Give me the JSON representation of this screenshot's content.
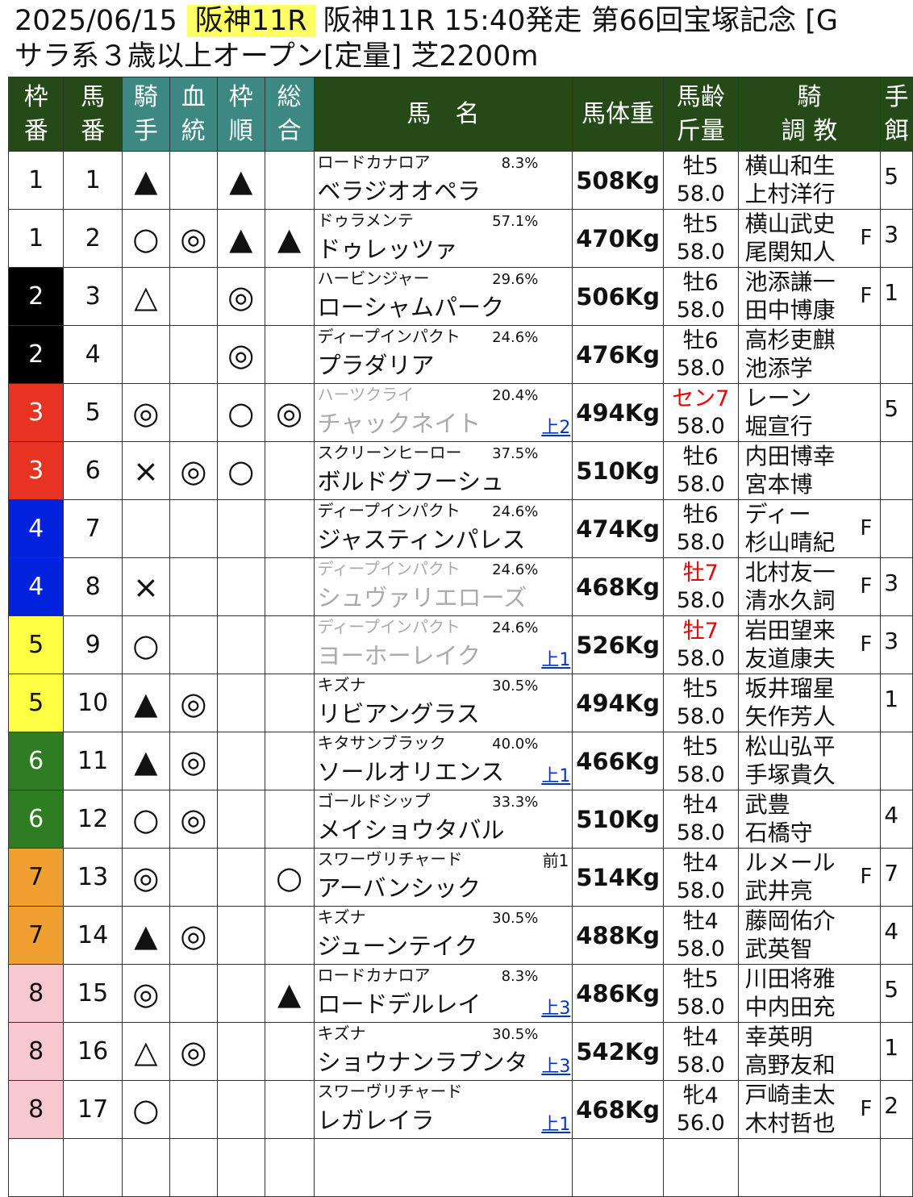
{
  "header": {
    "date": "2025/06/15",
    "race_tag": "阪神11R",
    "race_info": "阪神11R 15:40発走 第66回宝塚記念 [G",
    "conditions": "サラ系３歳以上オープン[定量] 芝2200m"
  },
  "columns": {
    "waku": [
      "枠",
      "番"
    ],
    "umaban": [
      "馬",
      "番"
    ],
    "jockey_mark": [
      "騎",
      "手"
    ],
    "blood_mark": [
      "血",
      "統"
    ],
    "waku_mark": [
      "枠",
      "順"
    ],
    "total_mark": [
      "総",
      "合"
    ],
    "horse_name": "馬　名",
    "weight": "馬体重",
    "age": [
      "馬齢",
      "斤量"
    ],
    "jockey": [
      "騎",
      "調 教"
    ],
    "extra": [
      "手",
      "餌"
    ]
  },
  "colors": {
    "header_bg": "#254a18",
    "mark_header_bg": "#3d8883",
    "waku_1": "#ffffff",
    "waku_2": "#000000",
    "waku_3": "#e83323",
    "waku_4": "#0022dd",
    "waku_5": "#ffff44",
    "waku_6": "#2e7d22",
    "waku_7": "#f0a030",
    "waku_8": "#f8c8d0"
  },
  "rows": [
    {
      "waku": "1",
      "num": "1",
      "jm": "▲",
      "bm": "",
      "wm": "▲",
      "tm": "",
      "sire": "ロードカナロア",
      "pct": "8.3%",
      "name": "ベラジオオペラ",
      "gray": false,
      "up": "",
      "mae": "",
      "weight": "508Kg",
      "age": "牡5",
      "age_red": false,
      "kin": "58.0",
      "j1": "横山和生",
      "j2": "上村洋行",
      "f": "",
      "ex": "5"
    },
    {
      "waku": "1",
      "num": "2",
      "jm": "○",
      "bm": "◎",
      "wm": "▲",
      "tm": "▲",
      "sire": "ドゥラメンテ",
      "pct": "57.1%",
      "name": "ドゥレッツァ",
      "gray": false,
      "up": "",
      "mae": "",
      "weight": "470Kg",
      "age": "牡5",
      "age_red": false,
      "kin": "58.0",
      "j1": "横山武史",
      "j2": "尾関知人",
      "f": "F",
      "ex": "3"
    },
    {
      "waku": "2",
      "num": "3",
      "jm": "△",
      "bm": "",
      "wm": "◎",
      "tm": "",
      "sire": "ハービンジャー",
      "pct": "29.6%",
      "name": "ローシャムパーク",
      "gray": false,
      "up": "",
      "mae": "",
      "weight": "506Kg",
      "age": "牡6",
      "age_red": false,
      "kin": "58.0",
      "j1": "池添謙一",
      "j2": "田中博康",
      "f": "F",
      "ex": "1"
    },
    {
      "waku": "2",
      "num": "4",
      "jm": "",
      "bm": "",
      "wm": "◎",
      "tm": "",
      "sire": "ディープインパクト",
      "pct": "24.6%",
      "name": "プラダリア",
      "gray": false,
      "up": "",
      "mae": "",
      "weight": "476Kg",
      "age": "牡6",
      "age_red": false,
      "kin": "58.0",
      "j1": "高杉吏麒",
      "j2": "池添学",
      "f": "",
      "ex": ""
    },
    {
      "waku": "3",
      "num": "5",
      "jm": "◎",
      "bm": "",
      "wm": "○",
      "tm": "◎",
      "sire": "ハーツクライ",
      "pct": "20.4%",
      "name": "チャックネイト",
      "gray": true,
      "up": "上2",
      "mae": "",
      "weight": "494Kg",
      "age": "セン7",
      "age_red": true,
      "kin": "58.0",
      "j1": "レーン",
      "j2": "堀宣行",
      "f": "",
      "ex": "5"
    },
    {
      "waku": "3",
      "num": "6",
      "jm": "×",
      "bm": "◎",
      "wm": "○",
      "tm": "",
      "sire": "スクリーンヒーロー",
      "pct": "37.5%",
      "name": "ボルドグフーシュ",
      "gray": false,
      "up": "",
      "mae": "",
      "weight": "510Kg",
      "age": "牡6",
      "age_red": false,
      "kin": "58.0",
      "j1": "内田博幸",
      "j2": "宮本博",
      "f": "",
      "ex": ""
    },
    {
      "waku": "4",
      "num": "7",
      "jm": "",
      "bm": "",
      "wm": "",
      "tm": "",
      "sire": "ディープインパクト",
      "pct": "24.6%",
      "name": "ジャスティンパレス",
      "gray": false,
      "up": "",
      "mae": "",
      "weight": "474Kg",
      "age": "牡6",
      "age_red": false,
      "kin": "58.0",
      "j1": "ディー",
      "j2": "杉山晴紀",
      "f": "F",
      "ex": ""
    },
    {
      "waku": "4",
      "num": "8",
      "jm": "×",
      "bm": "",
      "wm": "",
      "tm": "",
      "sire": "ディープインパクト",
      "pct": "24.6%",
      "name": "シュヴァリエローズ",
      "gray": true,
      "up": "",
      "mae": "",
      "weight": "468Kg",
      "age": "牡7",
      "age_red": true,
      "kin": "58.0",
      "j1": "北村友一",
      "j2": "清水久詞",
      "f": "F",
      "ex": "3"
    },
    {
      "waku": "5",
      "num": "9",
      "jm": "○",
      "bm": "",
      "wm": "",
      "tm": "",
      "sire": "ディープインパクト",
      "pct": "24.6%",
      "name": "ヨーホーレイク",
      "gray": true,
      "up": "上1",
      "mae": "",
      "weight": "526Kg",
      "age": "牡7",
      "age_red": true,
      "kin": "58.0",
      "j1": "岩田望来",
      "j2": "友道康夫",
      "f": "F",
      "ex": "3"
    },
    {
      "waku": "5",
      "num": "10",
      "jm": "▲",
      "bm": "◎",
      "wm": "",
      "tm": "",
      "sire": "キズナ",
      "pct": "30.5%",
      "name": "リビアングラス",
      "gray": false,
      "up": "",
      "mae": "",
      "weight": "494Kg",
      "age": "牡5",
      "age_red": false,
      "kin": "58.0",
      "j1": "坂井瑠星",
      "j2": "矢作芳人",
      "f": "",
      "ex": "1"
    },
    {
      "waku": "6",
      "num": "11",
      "jm": "▲",
      "bm": "◎",
      "wm": "",
      "tm": "",
      "sire": "キタサンブラック",
      "pct": "40.0%",
      "name": "ソールオリエンス",
      "gray": false,
      "up": "上1",
      "mae": "",
      "weight": "466Kg",
      "age": "牡5",
      "age_red": false,
      "kin": "58.0",
      "j1": "松山弘平",
      "j2": "手塚貴久",
      "f": "",
      "ex": ""
    },
    {
      "waku": "6",
      "num": "12",
      "jm": "○",
      "bm": "◎",
      "wm": "",
      "tm": "",
      "sire": "ゴールドシップ",
      "pct": "33.3%",
      "name": "メイショウタバル",
      "gray": false,
      "up": "",
      "mae": "",
      "weight": "510Kg",
      "age": "牡4",
      "age_red": false,
      "kin": "58.0",
      "j1": "武豊",
      "j2": "石橋守",
      "f": "",
      "ex": "4"
    },
    {
      "waku": "7",
      "num": "13",
      "jm": "◎",
      "bm": "",
      "wm": "",
      "tm": "○",
      "sire": "スワーヴリチャード",
      "pct": "",
      "name": "アーバンシック",
      "gray": false,
      "up": "",
      "mae": "前1",
      "weight": "514Kg",
      "age": "牡4",
      "age_red": false,
      "kin": "58.0",
      "j1": "ルメール",
      "j2": "武井亮",
      "f": "F",
      "ex": "7"
    },
    {
      "waku": "7",
      "num": "14",
      "jm": "▲",
      "bm": "◎",
      "wm": "",
      "tm": "",
      "sire": "キズナ",
      "pct": "30.5%",
      "name": "ジューンテイク",
      "gray": false,
      "up": "",
      "mae": "",
      "weight": "488Kg",
      "age": "牡4",
      "age_red": false,
      "kin": "58.0",
      "j1": "藤岡佑介",
      "j2": "武英智",
      "f": "",
      "ex": "4"
    },
    {
      "waku": "8",
      "num": "15",
      "jm": "◎",
      "bm": "",
      "wm": "",
      "tm": "▲",
      "sire": "ロードカナロア",
      "pct": "8.3%",
      "name": "ロードデルレイ",
      "gray": false,
      "up": "上3",
      "mae": "",
      "weight": "486Kg",
      "age": "牡5",
      "age_red": false,
      "kin": "58.0",
      "j1": "川田将雅",
      "j2": "中内田充",
      "f": "",
      "ex": "5"
    },
    {
      "waku": "8",
      "num": "16",
      "jm": "△",
      "bm": "◎",
      "wm": "",
      "tm": "",
      "sire": "キズナ",
      "pct": "30.5%",
      "name": "ショウナンラプンタ",
      "gray": false,
      "up": "上3",
      "mae": "",
      "weight": "542Kg",
      "age": "牡4",
      "age_red": false,
      "kin": "58.0",
      "j1": "幸英明",
      "j2": "高野友和",
      "f": "",
      "ex": "1"
    },
    {
      "waku": "8",
      "num": "17",
      "jm": "○",
      "bm": "",
      "wm": "",
      "tm": "",
      "sire": "スワーヴリチャード",
      "pct": "",
      "name": "レガレイラ",
      "gray": false,
      "up": "上1",
      "mae": "",
      "weight": "468Kg",
      "age": "牝4",
      "age_red": false,
      "kin": "56.0",
      "j1": "戸崎圭太",
      "j2": "木村哲也",
      "f": "F",
      "ex": "2"
    }
  ]
}
